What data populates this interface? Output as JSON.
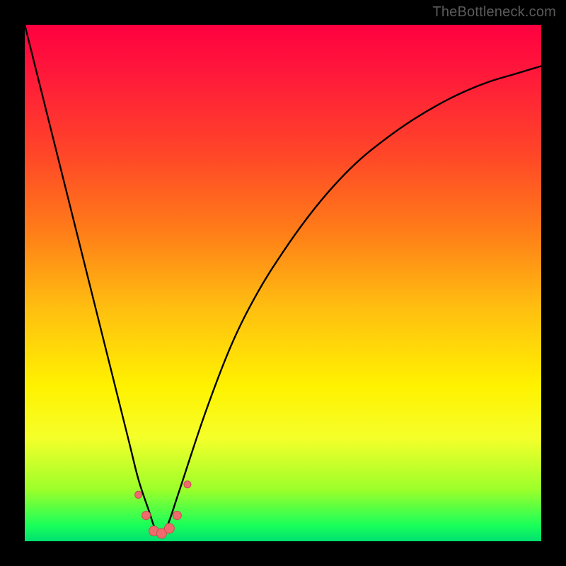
{
  "watermark": "TheBottleneck.com",
  "colors": {
    "frame": "#000000",
    "curve_stroke": "#000000",
    "marker_fill": "#ee6a6c",
    "marker_stroke": "#c94d52"
  },
  "chart_data": {
    "type": "line",
    "title": "",
    "xlabel": "",
    "ylabel": "",
    "xlim": [
      0,
      100
    ],
    "ylim": [
      0,
      100
    ],
    "grid": false,
    "legend": false,
    "description": "Bottleneck-style V-shaped curve over a vertical rainbow gradient. Background color maps bottleneck level: red high, green low. Curve dips to near zero around x≈26 (lowest bottleneck / optimal point) and rises steeply to the left and more gradually to the right.",
    "series": [
      {
        "name": "curve",
        "x": [
          0,
          5,
          10,
          15,
          20,
          22,
          24,
          25,
          26,
          27,
          28,
          30,
          35,
          40,
          45,
          50,
          55,
          60,
          65,
          70,
          75,
          80,
          85,
          90,
          95,
          100
        ],
        "values": [
          100,
          80,
          60,
          40,
          20,
          12,
          6,
          3,
          1,
          2,
          4,
          10,
          25,
          38,
          48,
          56,
          63,
          69,
          74,
          78,
          81.5,
          84.5,
          87,
          89,
          90.5,
          92
        ]
      }
    ],
    "markers": {
      "name": "bottom-cluster",
      "description": "Cluster of pink/coral circular markers near the curve minimum (bottom of the V).",
      "points": [
        {
          "x": 22.0,
          "y": 9.0,
          "r": 5
        },
        {
          "x": 23.5,
          "y": 5.0,
          "r": 6
        },
        {
          "x": 25.0,
          "y": 2.0,
          "r": 7
        },
        {
          "x": 26.5,
          "y": 1.5,
          "r": 7
        },
        {
          "x": 28.0,
          "y": 2.5,
          "r": 7
        },
        {
          "x": 29.5,
          "y": 5.0,
          "r": 6
        },
        {
          "x": 31.5,
          "y": 11.0,
          "r": 5
        }
      ]
    }
  }
}
